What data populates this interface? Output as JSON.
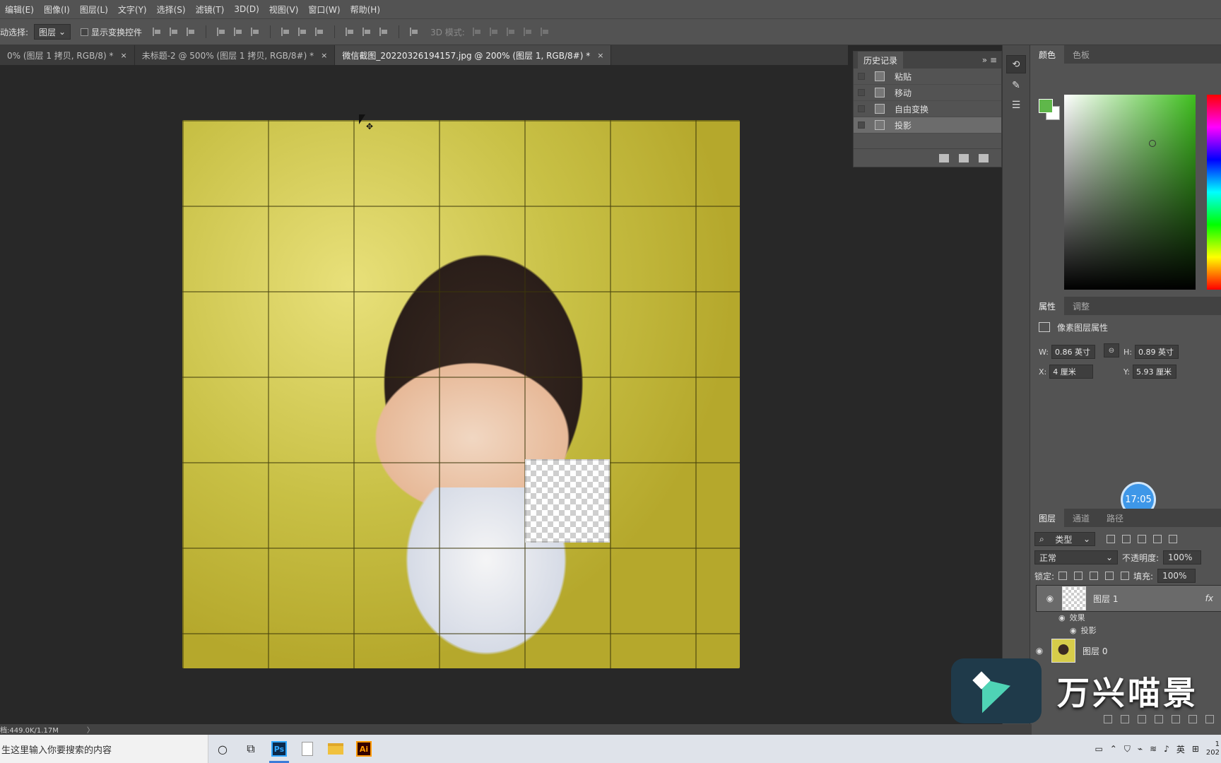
{
  "menubar": {
    "items": [
      "编辑(E)",
      "图像(I)",
      "图层(L)",
      "文字(Y)",
      "选择(S)",
      "滤镜(T)",
      "3D(D)",
      "视图(V)",
      "窗口(W)",
      "帮助(H)"
    ]
  },
  "options": {
    "auto_select_label": "动选择:",
    "auto_select_value": "图层",
    "show_transform_label": "显示变换控件",
    "mode_3d_label": "3D 模式:"
  },
  "tabs": [
    {
      "label": "0% (图层 1 拷贝, RGB/8) *",
      "close": "×"
    },
    {
      "label": "未标题-2 @ 500% (图层 1 拷贝, RGB/8#) *",
      "close": "×"
    },
    {
      "label": "微信截图_20220326194157.jpg @ 200% (图层 1, RGB/8#) *",
      "close": "×"
    }
  ],
  "history": {
    "title": "历史记录",
    "items": [
      "粘贴",
      "移动",
      "自由变换",
      "投影"
    ],
    "selected_index": 3
  },
  "color_panel": {
    "tabs": [
      "颜色",
      "色板"
    ],
    "foreground": "#5fb74a",
    "background": "#ffffff"
  },
  "properties": {
    "tabs": [
      "属性",
      "调整"
    ],
    "heading": "像素图层属性",
    "w_label": "W:",
    "w_value": "0.86 英寸",
    "h_label": "H:",
    "h_value": "0.89 英寸",
    "x_label": "X:",
    "x_value": "4 厘米",
    "y_label": "Y:",
    "y_value": "5.93 厘米"
  },
  "timer": "17:05",
  "layers_panel": {
    "tabs": [
      "图层",
      "通道",
      "路径"
    ],
    "filter_label": "类型",
    "blend_mode": "正常",
    "opacity_label": "不透明度:",
    "opacity_value": "100%",
    "lock_label": "锁定:",
    "fill_label": "填充:",
    "fill_value": "100%",
    "layers": [
      {
        "name": "图层 1",
        "fx": "fx",
        "effects_label": "效果",
        "effect": "投影"
      },
      {
        "name": "图层 0"
      }
    ]
  },
  "status": {
    "doc": "档:449.0K/1.17M",
    "chevron": "〉"
  },
  "taskbar": {
    "search_placeholder": "生这里输入你要搜索的内容",
    "ps_label": "Ps",
    "ai_label": "Ai",
    "ime": "英",
    "clock_top": "1",
    "clock_bottom": "202"
  },
  "watermark": {
    "text": "万兴喵景"
  }
}
